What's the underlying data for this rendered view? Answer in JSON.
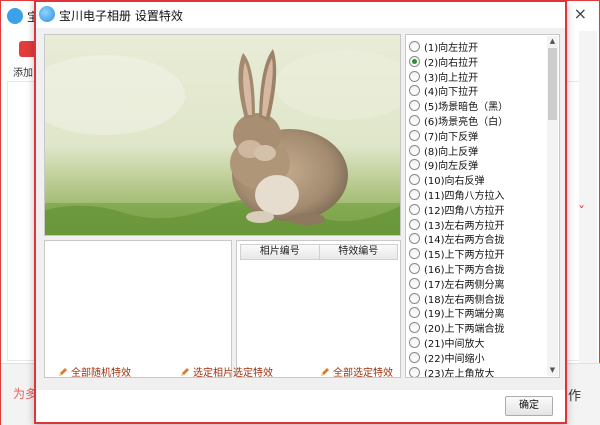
{
  "background_window": {
    "title": "宝川",
    "toolbar_label": "添加",
    "bottom_left": "为多",
    "bottom_right": "作",
    "close_glyph": "×"
  },
  "dialog": {
    "title": "宝川电子相册 设置特效",
    "table": {
      "headers": [
        "相片编号",
        "特效编号"
      ]
    },
    "actions": {
      "all_random": "全部随机特效",
      "selected_photo_effect": "选定相片选定特效",
      "all_selected_effect": "全部选定特效"
    },
    "ok_label": "确定",
    "effects": [
      "(1)向左拉开",
      "(2)向右拉开",
      "(3)向上拉开",
      "(4)向下拉开",
      "(5)场景暗色（黑）",
      "(6)场景亮色（白）",
      "(7)向下反弹",
      "(8)向上反弹",
      "(9)向左反弹",
      "(10)向右反弹",
      "(11)四角八方拉入",
      "(12)四角八方拉开",
      "(13)左右两方拉开",
      "(14)左右两方合拢",
      "(15)上下两方拉开",
      "(16)上下两方合拢",
      "(17)左右两侧分离",
      "(18)左右两侧合拢",
      "(19)上下两端分离",
      "(20)上下两端合拢",
      "(21)中间放大",
      "(22)中间缩小",
      "(23)左上角放大"
    ],
    "selected_effect_index": 1
  },
  "colors": {
    "accent_border": "#e0343a",
    "action_text": "#a0300c",
    "radio_checked": "#2f8e2f"
  }
}
